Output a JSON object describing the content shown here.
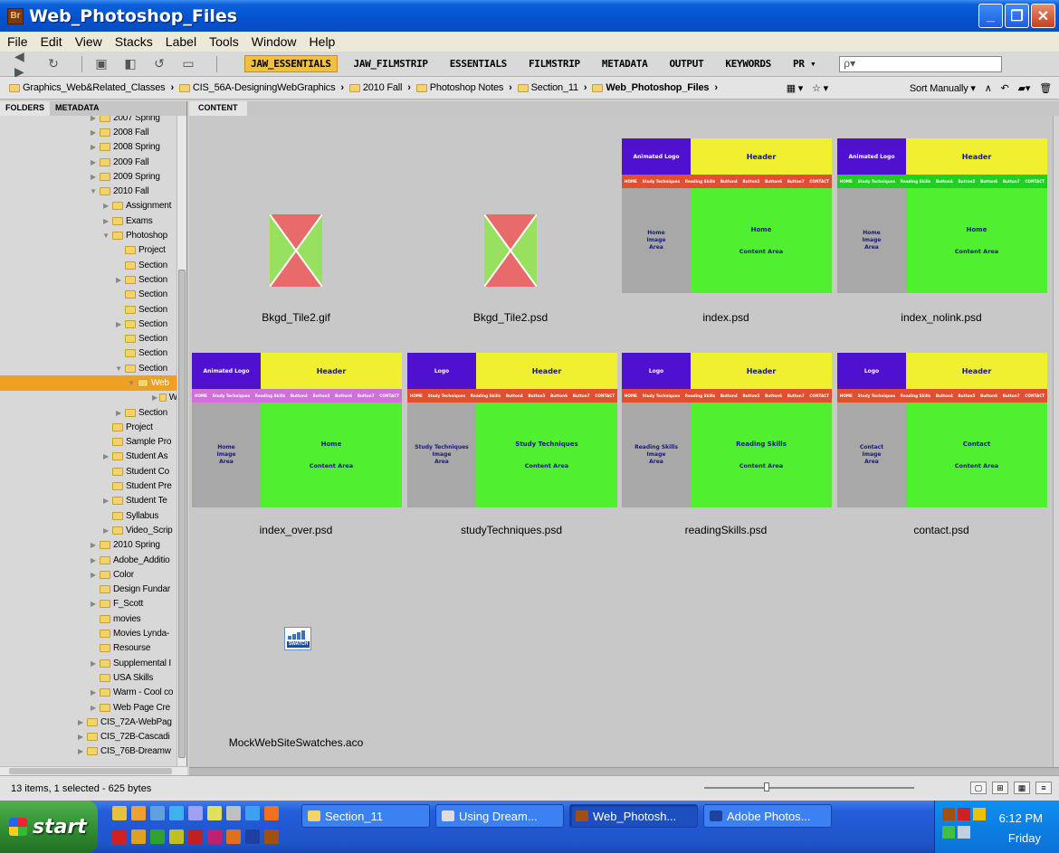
{
  "window": {
    "title": "Web_Photoshop_Files",
    "app_icon_text": "Br"
  },
  "menu": [
    "File",
    "Edit",
    "View",
    "Stacks",
    "Label",
    "Tools",
    "Window",
    "Help"
  ],
  "workspaces": [
    {
      "label": "JAW_ESSENTIALS",
      "active": true
    },
    {
      "label": "JAW_FILMSTRIP"
    },
    {
      "label": "ESSENTIALS"
    },
    {
      "label": "FILMSTRIP"
    },
    {
      "label": "METADATA"
    },
    {
      "label": "OUTPUT"
    },
    {
      "label": "KEYWORDS"
    },
    {
      "label": "PR ▾"
    }
  ],
  "search": {
    "placeholder": "ρ▾"
  },
  "breadcrumb": [
    {
      "label": "Graphics_Web&Related_Classes"
    },
    {
      "label": "CIS_56A-DesigningWebGraphics"
    },
    {
      "label": "2010 Fall"
    },
    {
      "label": "Photoshop Notes"
    },
    {
      "label": "Section_11"
    },
    {
      "label": "Web_Photoshop_Files",
      "bold": true
    }
  ],
  "sort_label": "Sort Manually ▾",
  "panels": {
    "folders_tab": "FOLDERS",
    "metadata_tab": "METADATA",
    "content_tab": "CONTENT"
  },
  "tree": [
    {
      "indent": 90,
      "tri": "▶",
      "label": "2007 Spring"
    },
    {
      "indent": 90,
      "tri": "▶",
      "label": "2008 Fall"
    },
    {
      "indent": 90,
      "tri": "▶",
      "label": "2008 Spring"
    },
    {
      "indent": 90,
      "tri": "▶",
      "label": "2009 Fall"
    },
    {
      "indent": 90,
      "tri": "▶",
      "label": "2009 Spring"
    },
    {
      "indent": 90,
      "tri": "▼",
      "label": "2010 Fall"
    },
    {
      "indent": 104,
      "tri": "▶",
      "label": "Assignment"
    },
    {
      "indent": 104,
      "tri": "▶",
      "label": "Exams"
    },
    {
      "indent": 104,
      "tri": "▼",
      "label": "Photoshop"
    },
    {
      "indent": 118,
      "tri": "",
      "label": "Project"
    },
    {
      "indent": 118,
      "tri": "",
      "label": "Section"
    },
    {
      "indent": 118,
      "tri": "▶",
      "label": "Section"
    },
    {
      "indent": 118,
      "tri": "",
      "label": "Section"
    },
    {
      "indent": 118,
      "tri": "",
      "label": "Section"
    },
    {
      "indent": 118,
      "tri": "▶",
      "label": "Section"
    },
    {
      "indent": 118,
      "tri": "",
      "label": "Section"
    },
    {
      "indent": 118,
      "tri": "",
      "label": "Section"
    },
    {
      "indent": 118,
      "tri": "▼",
      "label": "Section"
    },
    {
      "indent": 132,
      "tri": "▼",
      "label": "Web",
      "selected": true
    },
    {
      "indent": 160,
      "tri": "▶",
      "label": "W"
    },
    {
      "indent": 118,
      "tri": "▶",
      "label": "Section"
    },
    {
      "indent": 104,
      "tri": "",
      "label": "Project"
    },
    {
      "indent": 104,
      "tri": "",
      "label": "Sample Pro"
    },
    {
      "indent": 104,
      "tri": "▶",
      "label": "Student As"
    },
    {
      "indent": 104,
      "tri": "",
      "label": "Student Co"
    },
    {
      "indent": 104,
      "tri": "",
      "label": "Student Pre"
    },
    {
      "indent": 104,
      "tri": "▶",
      "label": "Student Te"
    },
    {
      "indent": 104,
      "tri": "",
      "label": "Syllabus"
    },
    {
      "indent": 104,
      "tri": "▶",
      "label": "Video_Scrip"
    },
    {
      "indent": 90,
      "tri": "▶",
      "label": "2010 Spring"
    },
    {
      "indent": 90,
      "tri": "▶",
      "label": "Adobe_Additio"
    },
    {
      "indent": 90,
      "tri": "▶",
      "label": "Color"
    },
    {
      "indent": 90,
      "tri": "",
      "label": "Design Fundar"
    },
    {
      "indent": 90,
      "tri": "▶",
      "label": "F_Scott"
    },
    {
      "indent": 90,
      "tri": "",
      "label": "movies"
    },
    {
      "indent": 90,
      "tri": "",
      "label": "Movies Lynda-"
    },
    {
      "indent": 90,
      "tri": "",
      "label": "Resourse"
    },
    {
      "indent": 90,
      "tri": "▶",
      "label": "Supplemental I"
    },
    {
      "indent": 90,
      "tri": "",
      "label": "USA Skills"
    },
    {
      "indent": 90,
      "tri": "▶",
      "label": "Warm - Cool co"
    },
    {
      "indent": 90,
      "tri": "▶",
      "label": "Web Page Cre"
    },
    {
      "indent": 76,
      "tri": "▶",
      "label": "CIS_72A-WebPag"
    },
    {
      "indent": 76,
      "tri": "▶",
      "label": "CIS_72B-Cascadi"
    },
    {
      "indent": 76,
      "tri": "▶",
      "label": "CIS_76B-Dreamw"
    }
  ],
  "files": {
    "tile1": "Bkgd_Tile2.gif",
    "tile2": "Bkgd_Tile2.psd",
    "swatch": "MockWebSiteSwatches.aco",
    "swatch_icon_text": "SWATCH"
  },
  "mocks": [
    {
      "file": "index.psd",
      "logo": "Animated Logo",
      "header": "Header",
      "nav_color": "red",
      "side": [
        "Home",
        "Image",
        "Area"
      ],
      "main_title": "Home",
      "main_sub": "Content Area"
    },
    {
      "file": "index_nolink.psd",
      "logo": "Animated Logo",
      "header": "Header",
      "nav_color": "green",
      "side": [
        "Home",
        "Image",
        "Area"
      ],
      "main_title": "Home",
      "main_sub": "Content Area"
    },
    {
      "file": "index_over.psd",
      "logo": "Animated Logo",
      "header": "Header",
      "nav_color": "pink",
      "side": [
        "Home",
        "Image",
        "Area"
      ],
      "main_title": "Home",
      "main_sub": "Content Area"
    },
    {
      "file": "studyTechniques.psd",
      "logo": "Logo",
      "header": "Header",
      "nav_color": "red",
      "side": [
        "Study Techniques",
        "Image",
        "Area"
      ],
      "main_title": "Study Techniques",
      "main_sub": "Content Area"
    },
    {
      "file": "readingSkills.psd",
      "logo": "Logo",
      "header": "Header",
      "nav_color": "red",
      "side": [
        "Reading Skills",
        "Image",
        "Area"
      ],
      "main_title": "Reading Skills",
      "main_sub": "Content Area"
    },
    {
      "file": "contact.psd",
      "logo": "Logo",
      "header": "Header",
      "nav_color": "red",
      "side": [
        "Contact",
        "Image",
        "Area"
      ],
      "main_title": "Contact",
      "main_sub": "Content Area"
    }
  ],
  "nav_items": [
    "HOME",
    "Study Techniques",
    "Reading Skills",
    "Button4",
    "Button5",
    "Button6",
    "Button7",
    "CONTACT"
  ],
  "status": {
    "text": "13 items, 1 selected - 625 bytes"
  },
  "taskbar": {
    "start": "start",
    "tasks": [
      "Section_11",
      "Using Dream...",
      "Web_Photosh...",
      "Adobe Photos..."
    ],
    "time": "6:12 PM",
    "day": "Friday"
  },
  "colors": {
    "logo": "#5010d0",
    "header": "#f0f030",
    "nav_red": "#e05030",
    "nav_green": "#20d020",
    "nav_pink": "#d070d8",
    "content": "#50f030",
    "side": "#a8a8a8"
  }
}
